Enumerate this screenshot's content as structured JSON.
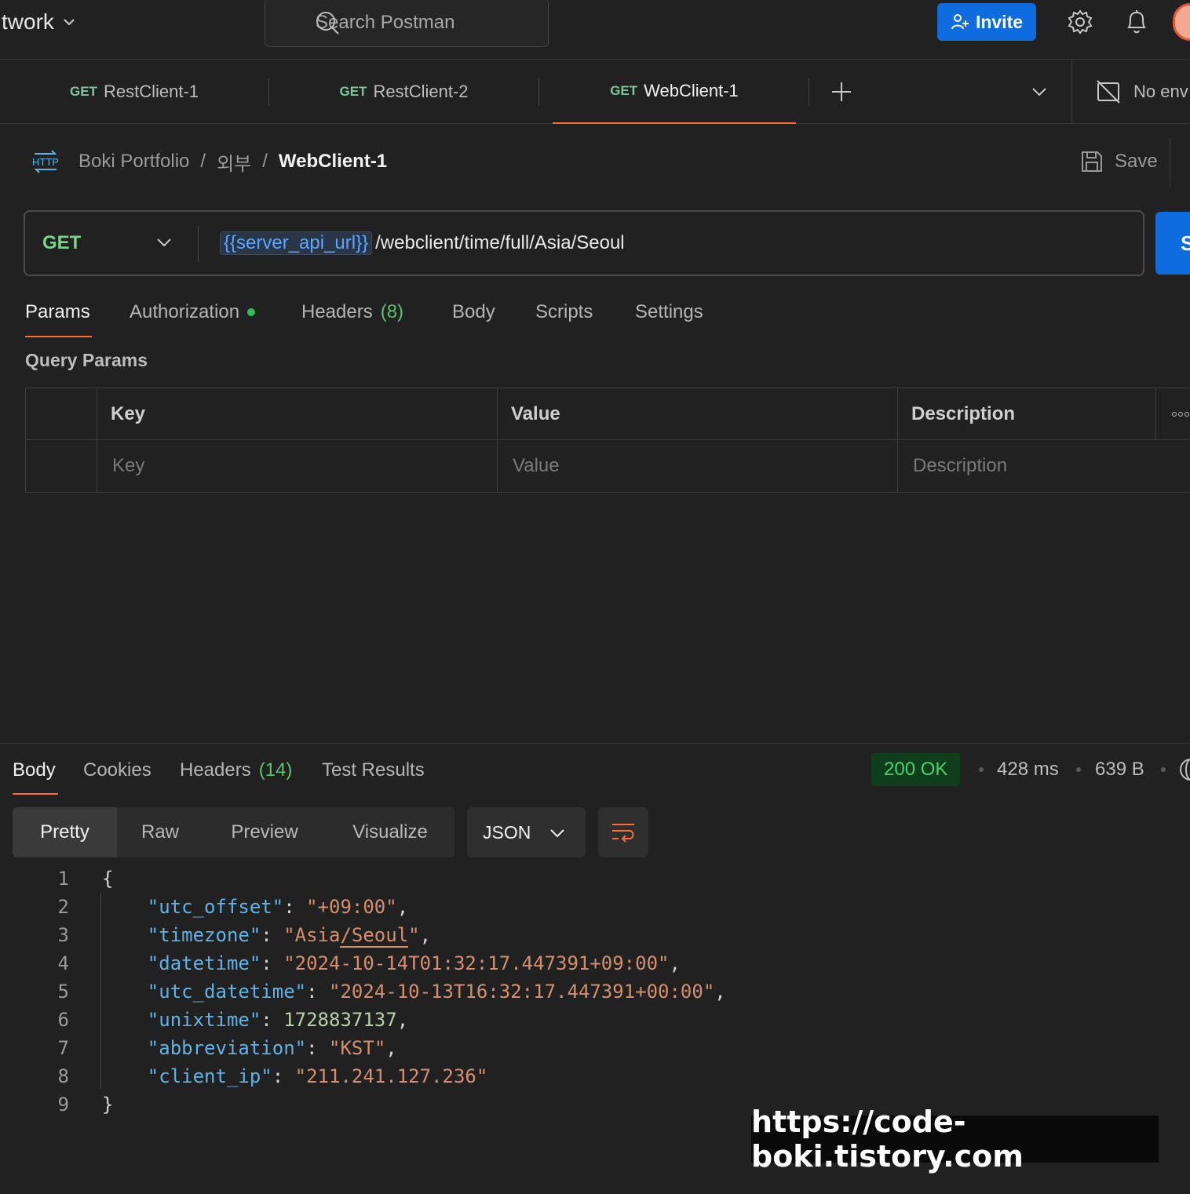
{
  "header": {
    "workspace": "twork",
    "search_placeholder": "Search Postman",
    "invite_label": "Invite"
  },
  "tabs": [
    {
      "method": "GET",
      "name": "RestClient-1"
    },
    {
      "method": "GET",
      "name": "RestClient-2"
    },
    {
      "method": "GET",
      "name": "WebClient-1"
    }
  ],
  "environment": {
    "label": "No env"
  },
  "breadcrumb": {
    "collection": "Boki Portfolio",
    "folder": "외부",
    "request": "WebClient-1",
    "separator": "/"
  },
  "save_label": "Save",
  "request": {
    "method": "GET",
    "url_variable": "{{server_api_url}}",
    "url_path": "/webclient/time/full/Asia/Seoul",
    "send_label": "S"
  },
  "request_tabs": [
    {
      "label": "Params"
    },
    {
      "label": "Authorization"
    },
    {
      "label": "Headers",
      "count": "(8)"
    },
    {
      "label": "Body"
    },
    {
      "label": "Scripts"
    },
    {
      "label": "Settings"
    }
  ],
  "query_params": {
    "title": "Query Params",
    "columns": [
      "Key",
      "Value",
      "Description"
    ],
    "placeholders": [
      "Key",
      "Value",
      "Description"
    ]
  },
  "response": {
    "tabs": [
      {
        "label": "Body"
      },
      {
        "label": "Cookies"
      },
      {
        "label": "Headers",
        "count": "(14)"
      },
      {
        "label": "Test Results"
      }
    ],
    "status": "200 OK",
    "time": "428 ms",
    "size": "639 B",
    "view_modes": [
      "Pretty",
      "Raw",
      "Preview",
      "Visualize"
    ],
    "format": "JSON",
    "line_numbers": [
      "1",
      "2",
      "3",
      "4",
      "5",
      "6",
      "7",
      "8",
      "9"
    ],
    "json": {
      "utc_offset": "+09:00",
      "timezone_a": "Asia",
      "timezone_b": "Seoul",
      "datetime": "2024-10-14T01:32:17.447391+09:00",
      "utc_datetime": "2024-10-13T16:32:17.447391+00:00",
      "unixtime": "1728837137",
      "abbreviation": "KST",
      "client_ip": "211.241.127.236"
    }
  },
  "watermark": "https://code-boki.tistory.com",
  "colors": {
    "accent": "#ff6c37",
    "primary": "#0f6cde",
    "status_ok": "#49d06a"
  }
}
